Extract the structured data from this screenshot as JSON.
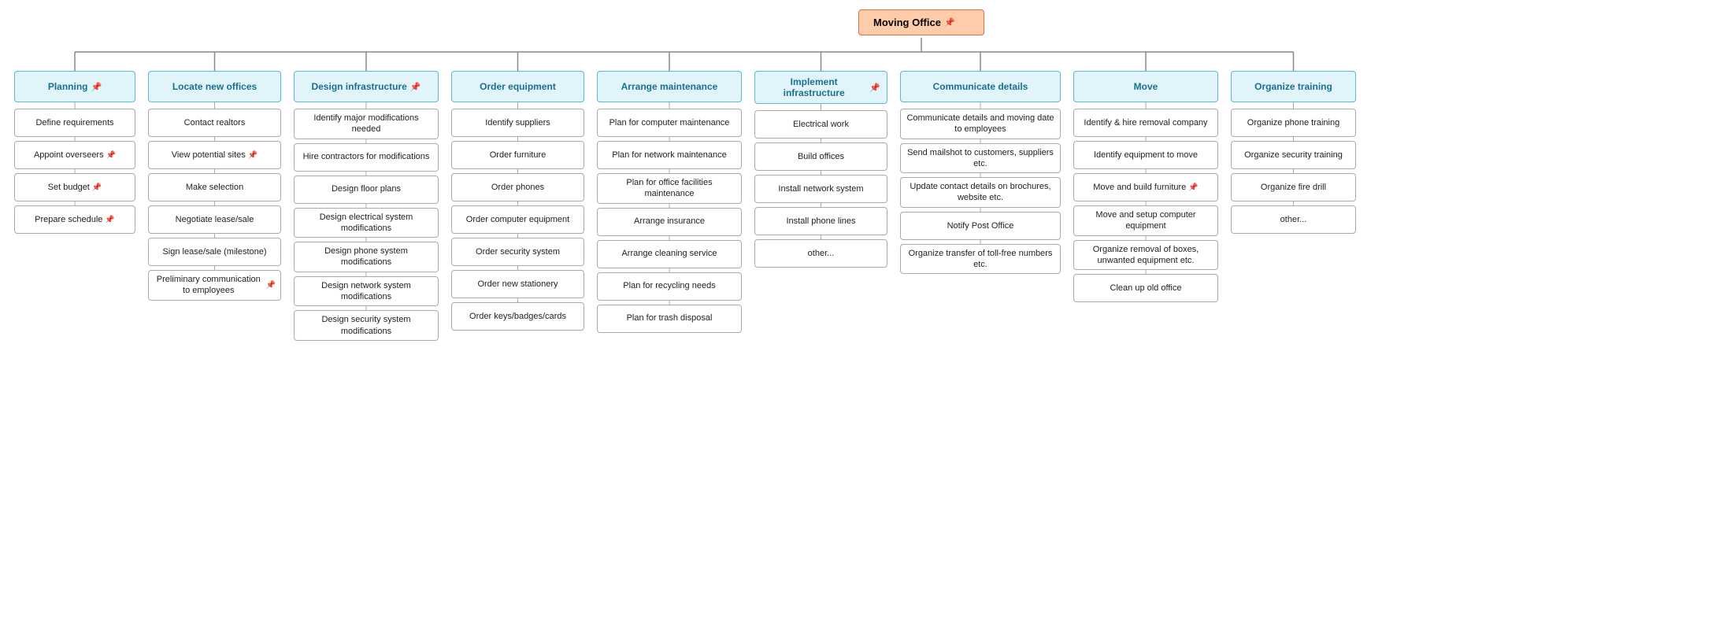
{
  "root": {
    "label": "Moving Office",
    "has_note": true
  },
  "columns": [
    {
      "id": "planning",
      "header": "Planning",
      "has_note": true,
      "items": [
        {
          "label": "Define requirements",
          "has_note": false
        },
        {
          "label": "Appoint overseers",
          "has_note": true
        },
        {
          "label": "Set budget",
          "has_note": true
        },
        {
          "label": "Prepare schedule",
          "has_note": true
        }
      ]
    },
    {
      "id": "locate",
      "header": "Locate new offices",
      "has_note": false,
      "items": [
        {
          "label": "Contact realtors",
          "has_note": false
        },
        {
          "label": "View potential sites",
          "has_note": true
        },
        {
          "label": "Make selection",
          "has_note": false
        },
        {
          "label": "Negotiate lease/sale",
          "has_note": false
        },
        {
          "label": "Sign lease/sale (milestone)",
          "has_note": false
        },
        {
          "label": "Preliminary communication to employees",
          "has_note": true
        }
      ]
    },
    {
      "id": "design",
      "header": "Design infrastructure",
      "has_note": true,
      "items": [
        {
          "label": "Identify major modifications needed",
          "has_note": false
        },
        {
          "label": "Hire contractors for modifications",
          "has_note": false
        },
        {
          "label": "Design floor plans",
          "has_note": false
        },
        {
          "label": "Design electrical system modifications",
          "has_note": false
        },
        {
          "label": "Design phone system modifications",
          "has_note": false
        },
        {
          "label": "Design network system modifications",
          "has_note": false
        },
        {
          "label": "Design security system modifications",
          "has_note": false
        }
      ]
    },
    {
      "id": "order",
      "header": "Order equipment",
      "has_note": false,
      "items": [
        {
          "label": "Identify suppliers",
          "has_note": false
        },
        {
          "label": "Order furniture",
          "has_note": false
        },
        {
          "label": "Order phones",
          "has_note": false
        },
        {
          "label": "Order computer equipment",
          "has_note": false
        },
        {
          "label": "Order security system",
          "has_note": false
        },
        {
          "label": "Order new stationery",
          "has_note": false
        },
        {
          "label": "Order keys/badges/cards",
          "has_note": false
        }
      ]
    },
    {
      "id": "arrange",
      "header": "Arrange maintenance",
      "has_note": false,
      "items": [
        {
          "label": "Plan for computer maintenance",
          "has_note": false
        },
        {
          "label": "Plan for network maintenance",
          "has_note": false
        },
        {
          "label": "Plan for office facilities maintenance",
          "has_note": false
        },
        {
          "label": "Arrange insurance",
          "has_note": false
        },
        {
          "label": "Arrange cleaning service",
          "has_note": false
        },
        {
          "label": "Plan for recycling needs",
          "has_note": false
        },
        {
          "label": "Plan for trash disposal",
          "has_note": false
        }
      ]
    },
    {
      "id": "implement",
      "header": "Implement infrastructure",
      "has_note": true,
      "items": [
        {
          "label": "Electrical work",
          "has_note": false
        },
        {
          "label": "Build offices",
          "has_note": false
        },
        {
          "label": "Install network system",
          "has_note": false
        },
        {
          "label": "Install phone lines",
          "has_note": false
        },
        {
          "label": "other...",
          "has_note": false
        }
      ]
    },
    {
      "id": "communicate",
      "header": "Communicate details",
      "has_note": false,
      "items": [
        {
          "label": "Communicate details and moving date to employees",
          "has_note": false
        },
        {
          "label": "Send mailshot to customers, suppliers etc.",
          "has_note": false
        },
        {
          "label": "Update contact details on brochures, website etc.",
          "has_note": false
        },
        {
          "label": "Notify Post Office",
          "has_note": false
        },
        {
          "label": "Organize transfer of toll-free numbers etc.",
          "has_note": false
        }
      ]
    },
    {
      "id": "move",
      "header": "Move",
      "has_note": false,
      "items": [
        {
          "label": "Identify & hire removal company",
          "has_note": false
        },
        {
          "label": "Identify equipment to move",
          "has_note": false
        },
        {
          "label": "Move and build furniture",
          "has_note": true
        },
        {
          "label": "Move and setup computer equipment",
          "has_note": false
        },
        {
          "label": "Organize removal of boxes, unwanted equipment etc.",
          "has_note": false
        },
        {
          "label": "Clean up old office",
          "has_note": false
        }
      ]
    },
    {
      "id": "training",
      "header": "Organize training",
      "has_note": false,
      "items": [
        {
          "label": "Organize phone training",
          "has_note": false
        },
        {
          "label": "Organize security training",
          "has_note": false
        },
        {
          "label": "Organize fire drill",
          "has_note": false
        },
        {
          "label": "other...",
          "has_note": false
        }
      ]
    }
  ]
}
